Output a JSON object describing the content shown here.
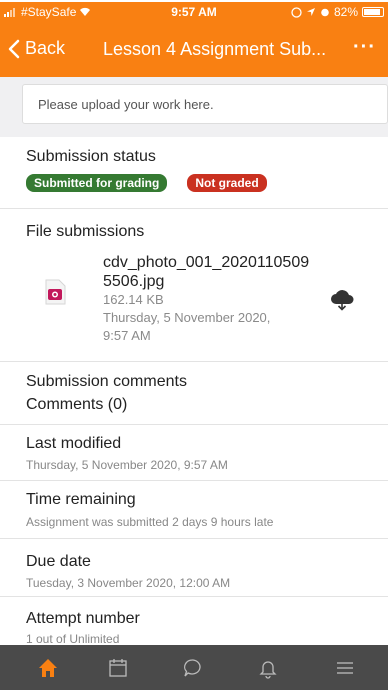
{
  "status_bar": {
    "carrier": "#StaySafe",
    "time": "9:57 AM",
    "battery": "82%"
  },
  "nav": {
    "back_label": "Back",
    "title": "Lesson 4 Assignment Sub...",
    "more_label": "···"
  },
  "upload": {
    "prompt": "Please upload your work here."
  },
  "submission_status": {
    "title": "Submission status",
    "status_badge": "Submitted for grading",
    "grading_badge": "Not graded"
  },
  "file_submissions": {
    "title": "File submissions",
    "file_name": "cdv_photo_001_20201105095506.jpg",
    "file_name_line1": "cdv_photo_001_2020110509",
    "file_name_line2": "5506.jpg",
    "file_size": "162.14 KB",
    "file_date_line1": "Thursday, 5 November 2020,",
    "file_date_line2": "9:57 AM"
  },
  "submission_comments": {
    "title": "Submission comments",
    "comments": "Comments (0)"
  },
  "last_modified": {
    "title": "Last modified",
    "value": "Thursday, 5 November 2020, 9:57 AM"
  },
  "time_remaining": {
    "title": "Time remaining",
    "value": "Assignment was submitted 2 days 9 hours late"
  },
  "due_date": {
    "title": "Due date",
    "value": "Tuesday, 3 November 2020, 12:00 AM"
  },
  "attempt_number": {
    "title": "Attempt number",
    "value": "1 out of Unlimited"
  },
  "tab_bar": {
    "tabs": [
      "home-icon",
      "calendar-icon",
      "chat-icon",
      "bell-icon",
      "menu-icon"
    ],
    "active": "home-icon",
    "active_color": "#f98012"
  },
  "colors": {
    "brand": "#f98012",
    "badge_submitted": "#357a32",
    "badge_not_graded": "#ca3120"
  }
}
